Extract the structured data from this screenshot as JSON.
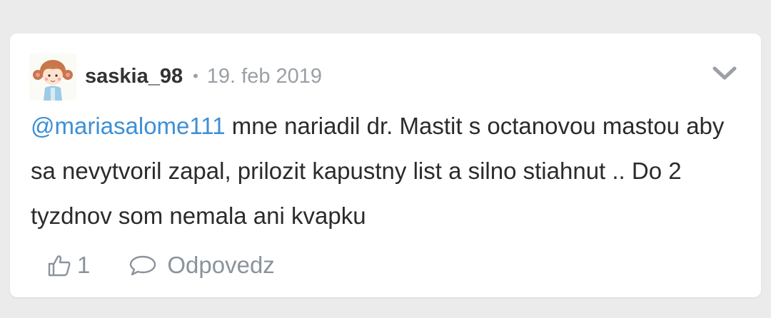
{
  "comment": {
    "username": "saskia_98",
    "separator": "•",
    "date": "19. feb 2019",
    "mention": "@mariasalome111",
    "text": " mne nariadil dr. Mastit s octanovou mastou aby sa nevytvoril zapal, prilozit kapustny list a silno stiahnut .. Do 2 tyzdnov som nemala ani kvapku",
    "likes": "1",
    "reply_label": "Odpovedz"
  },
  "colors": {
    "mention": "#3d8fd6",
    "muted": "#9aa0a6",
    "card": "#ffffff",
    "background": "#ebebeb"
  },
  "icons": {
    "avatar": "girl-avatar",
    "menu": "chevron-down-icon",
    "like": "thumbs-up-icon",
    "reply": "speech-bubble-icon"
  }
}
